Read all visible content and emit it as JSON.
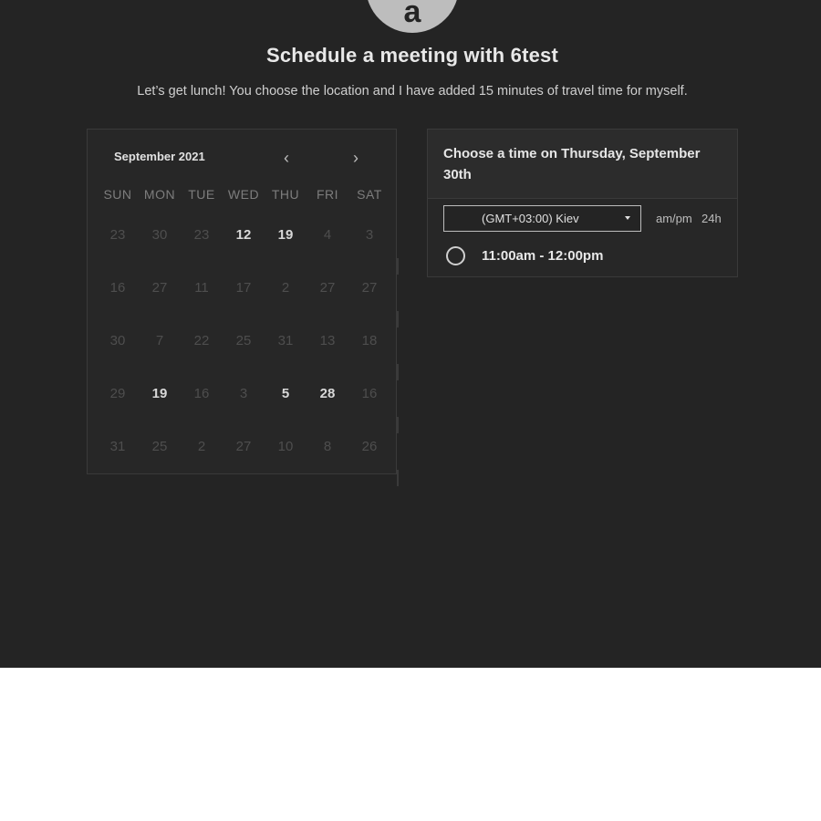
{
  "header": {
    "avatar_letter": "a",
    "title": "Schedule a meeting with 6test",
    "subtitle": "Let’s get lunch! You choose the location and I have added 15 minutes of travel time for myself."
  },
  "calendar": {
    "month_label": "September 2021",
    "prev_icon": "‹",
    "next_icon": "›",
    "weekdays": [
      "SUN",
      "MON",
      "TUE",
      "WED",
      "THU",
      "FRI",
      "SAT"
    ],
    "weeks": [
      [
        {
          "d": "23",
          "a": false
        },
        {
          "d": "30",
          "a": false
        },
        {
          "d": "23",
          "a": false
        },
        {
          "d": "12",
          "a": true
        },
        {
          "d": "19",
          "a": true
        },
        {
          "d": "4",
          "a": false
        },
        {
          "d": "3",
          "a": false
        }
      ],
      [
        {
          "d": "16",
          "a": false
        },
        {
          "d": "27",
          "a": false
        },
        {
          "d": "11",
          "a": false
        },
        {
          "d": "17",
          "a": false
        },
        {
          "d": "2",
          "a": false
        },
        {
          "d": "27",
          "a": false
        },
        {
          "d": "27",
          "a": false
        }
      ],
      [
        {
          "d": "30",
          "a": false
        },
        {
          "d": "7",
          "a": false
        },
        {
          "d": "22",
          "a": false
        },
        {
          "d": "25",
          "a": false
        },
        {
          "d": "31",
          "a": false
        },
        {
          "d": "13",
          "a": false
        },
        {
          "d": "18",
          "a": false
        }
      ],
      [
        {
          "d": "29",
          "a": false
        },
        {
          "d": "19",
          "a": true
        },
        {
          "d": "16",
          "a": false
        },
        {
          "d": "3",
          "a": false
        },
        {
          "d": "5",
          "a": true
        },
        {
          "d": "28",
          "a": true
        },
        {
          "d": "16",
          "a": false
        }
      ],
      [
        {
          "d": "31",
          "a": false
        },
        {
          "d": "25",
          "a": false
        },
        {
          "d": "2",
          "a": false
        },
        {
          "d": "27",
          "a": false
        },
        {
          "d": "10",
          "a": false
        },
        {
          "d": "8",
          "a": false
        },
        {
          "d": "26",
          "a": false
        }
      ]
    ]
  },
  "time_panel": {
    "heading": "Choose a time on Thursday, September 30th",
    "timezone": "(GMT+03:00) Kiev",
    "format_ampm": "am/pm",
    "format_24h": "24h",
    "slots": [
      "11:00am - 12:00pm"
    ]
  },
  "colors": {
    "background": "#242424",
    "panel": "#272727",
    "border": "#3a3a3a",
    "text": "#e8e8e8",
    "muted_day": "#4e4e4e"
  }
}
